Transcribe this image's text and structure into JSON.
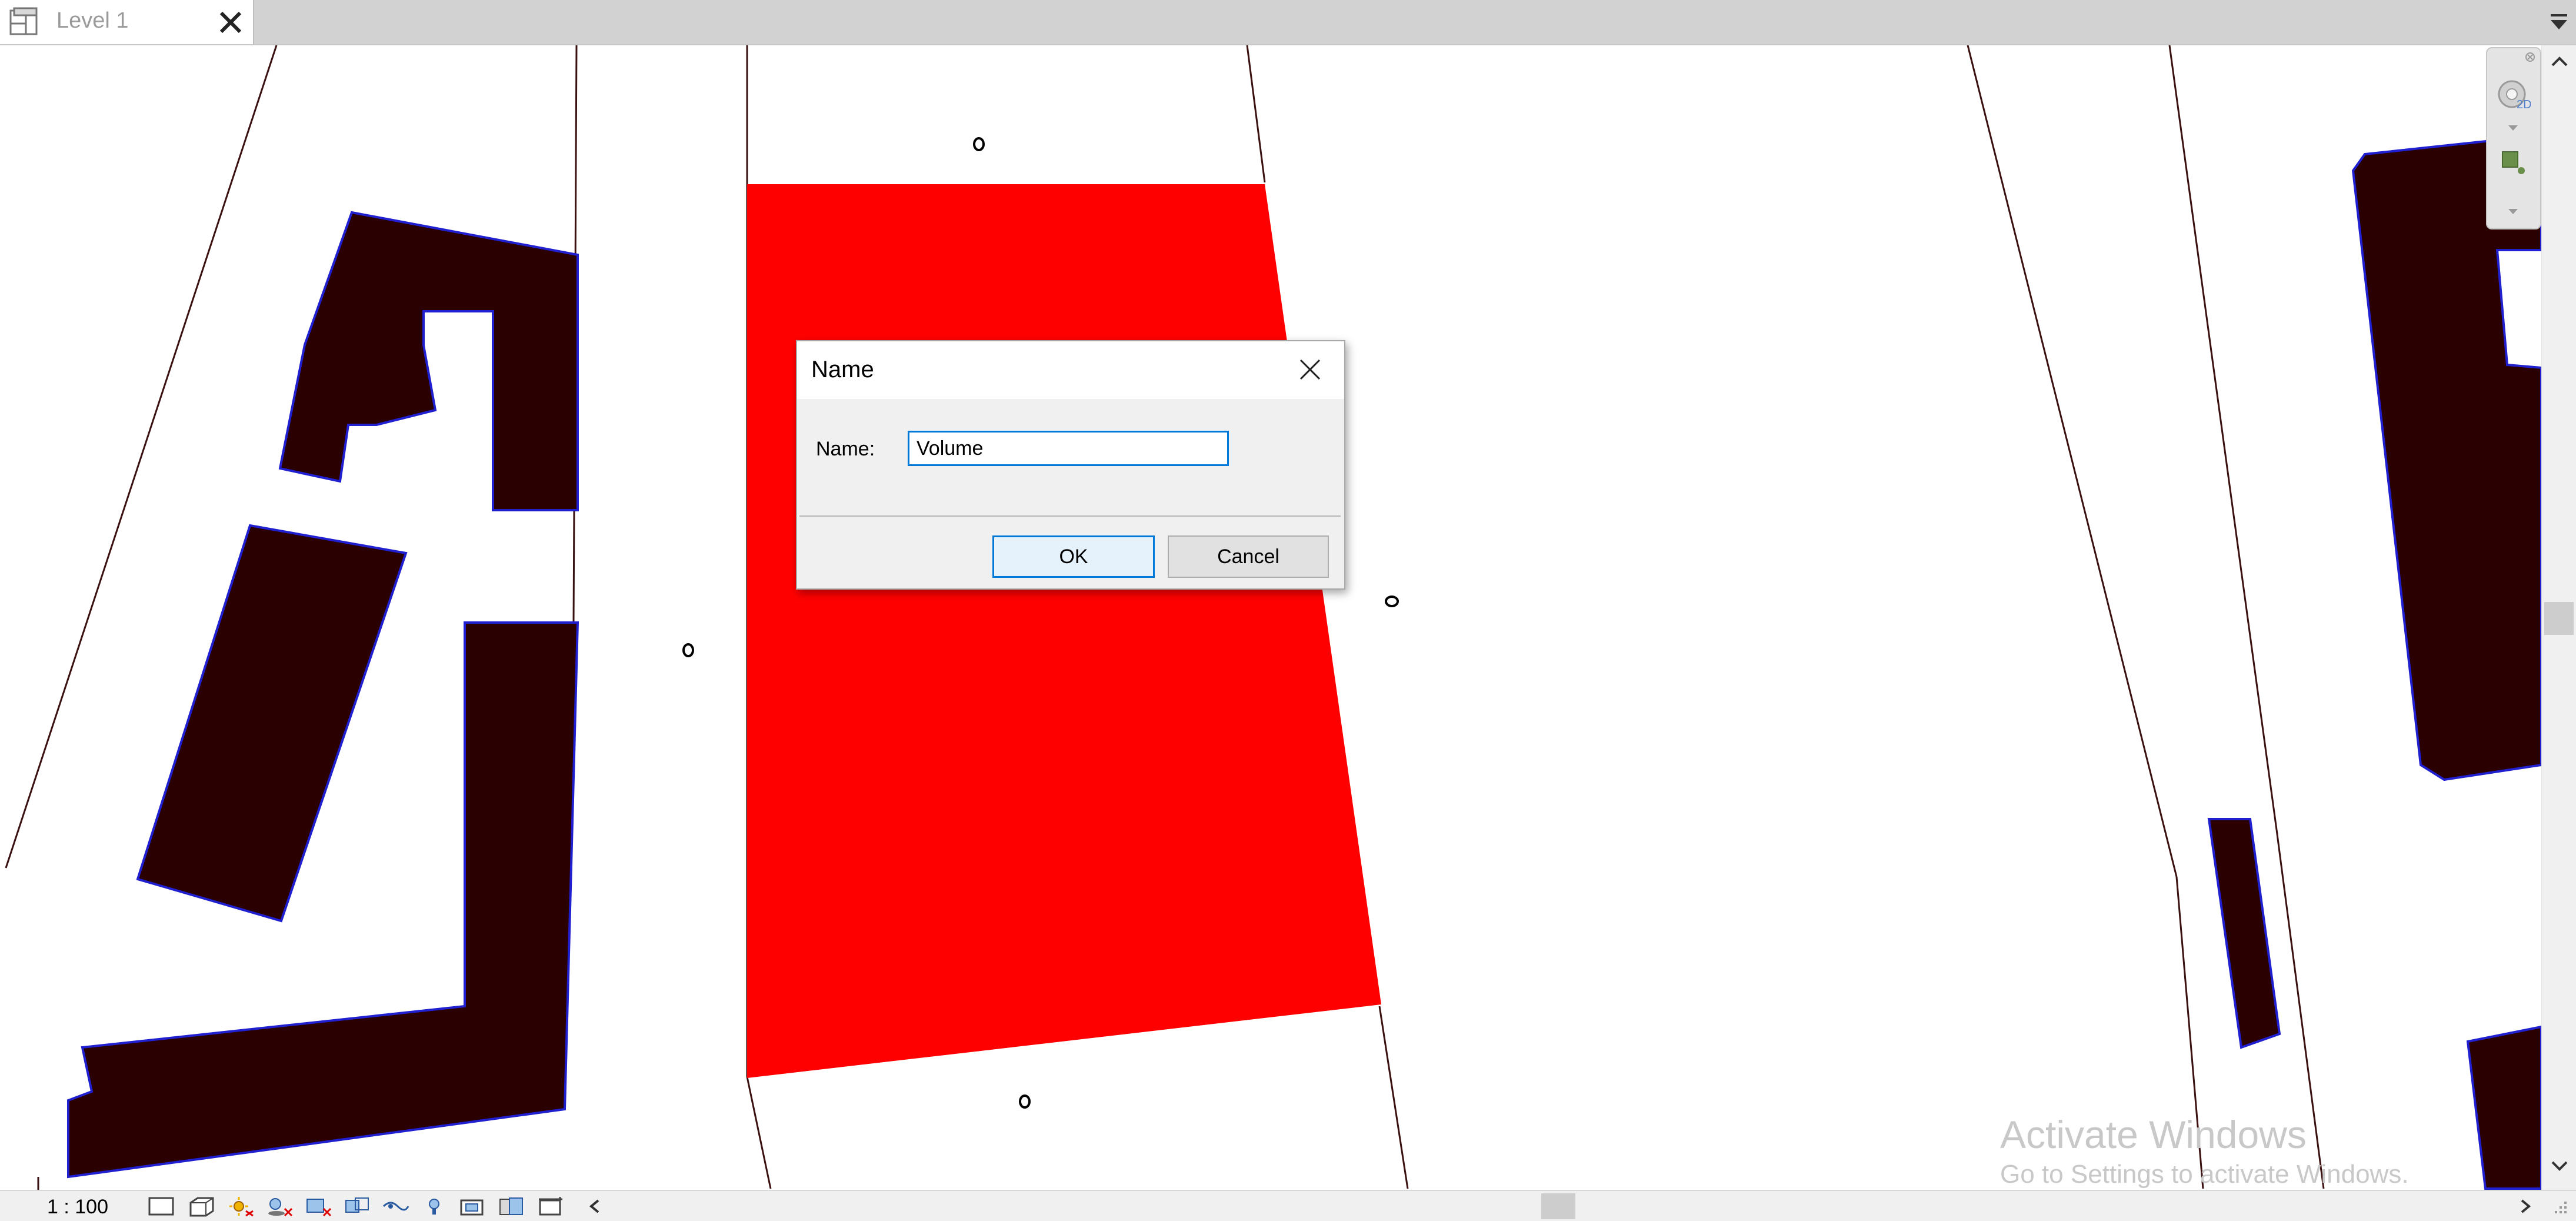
{
  "tab": {
    "label": "Level 1",
    "icon": "floor-plan-icon",
    "close_icon": "close-icon",
    "menu_icon": "tab-menu-icon"
  },
  "dialog": {
    "title": "Name",
    "field_label": "Name:",
    "field_value": "Volume",
    "ok_label": "OK",
    "cancel_label": "Cancel",
    "close_icon": "close-icon"
  },
  "status_bar": {
    "scale": "1 : 100",
    "view_control_icons": [
      "detail-level-icon",
      "visual-style-icon",
      "sun-path-icon",
      "shadows-icon",
      "crop-view-icon",
      "show-crop-region-icon",
      "temporary-hide-isolate-icon",
      "reveal-hidden-elements-icon",
      "temporary-view-properties-icon",
      "analytical-model-icon",
      "highlight-displacement-icon"
    ]
  },
  "navigation_bar": {
    "icons": [
      "navigation-wheel-icon",
      "zoom-icon"
    ]
  },
  "watermark": {
    "line1": "Activate Windows",
    "line2": "Go to Settings to activate Windows."
  },
  "colors": {
    "selected_mass": "#ff0000",
    "buildings": "#2a0000",
    "building_outline": "#2020d0",
    "dialog_accent": "#0078d7"
  }
}
